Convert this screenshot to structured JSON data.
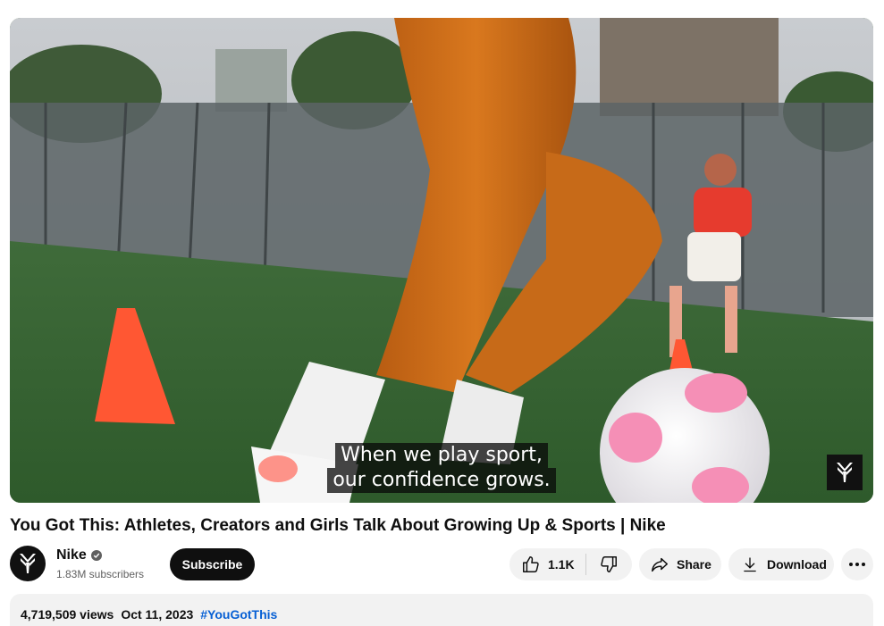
{
  "video": {
    "captions": [
      "When we play sport,",
      "our confidence grows."
    ],
    "title": "You Got This: Athletes, Creators and Girls Talk About Growing Up & Sports | Nike"
  },
  "channel": {
    "name": "Nike",
    "subscribers": "1.83M subscribers",
    "subscribe_label": "Subscribe",
    "avatar_icon": "nike-logo-icon"
  },
  "actions": {
    "like_count": "1.1K",
    "share_label": "Share",
    "download_label": "Download",
    "more_icon": "more-horizontal-icon"
  },
  "description": {
    "views": "4,719,509 views",
    "date": "Oct 11, 2023",
    "hashtag": "#YouGotThis"
  },
  "colors": {
    "subscribe_bg": "#0f0f0f",
    "pill_bg": "#f2f2f2",
    "hashtag": "#065fd4",
    "secondary_text": "#606060"
  }
}
